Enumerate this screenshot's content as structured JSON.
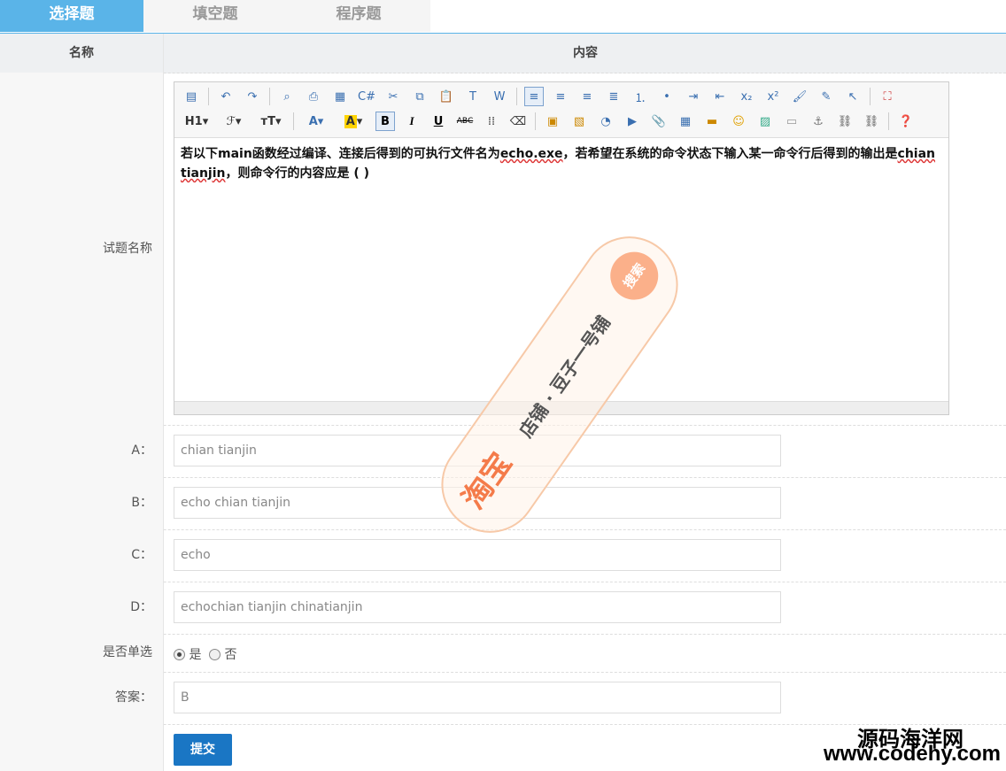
{
  "tabs": [
    "选择题",
    "填空题",
    "程序题"
  ],
  "header": {
    "name_col": "名称",
    "content_col": "内容"
  },
  "question": {
    "label": "试题名称",
    "text_part1": "若以下main函数经过编译、连接后得到的可执行文件名为",
    "text_exe": "echo.exe",
    "text_part2": "，若希望在系统的命令状态下输入某一命令行后得到的输出是",
    "text_chian": "chian tianjin",
    "text_part3": "，则命令行的内容应是 ( )"
  },
  "options": [
    {
      "label": "A：",
      "value": "chian tianjin"
    },
    {
      "label": "B：",
      "value": "echo chian tianjin"
    },
    {
      "label": "C：",
      "value": "echo"
    },
    {
      "label": "D：",
      "value": "echochian tianjin chinatianjin"
    }
  ],
  "single": {
    "label": "是否单选",
    "yes": "是",
    "no": "否",
    "selected": "是"
  },
  "answer": {
    "label": "答案：",
    "value": "B"
  },
  "submit_label": "提交",
  "toolbar_row2_text": {
    "h1": "H1",
    "font": "ℱ",
    "size": "тT",
    "color": "A",
    "bold": "B",
    "italic": "I",
    "underline": "U",
    "abc": "ABC"
  },
  "watermark": {
    "site_cn": "源码海洋网",
    "site_url": "www.codehy.com"
  },
  "stamp": {
    "brand": "淘宝",
    "shop": "店铺 · 豆子一号铺",
    "search": "搜索"
  }
}
